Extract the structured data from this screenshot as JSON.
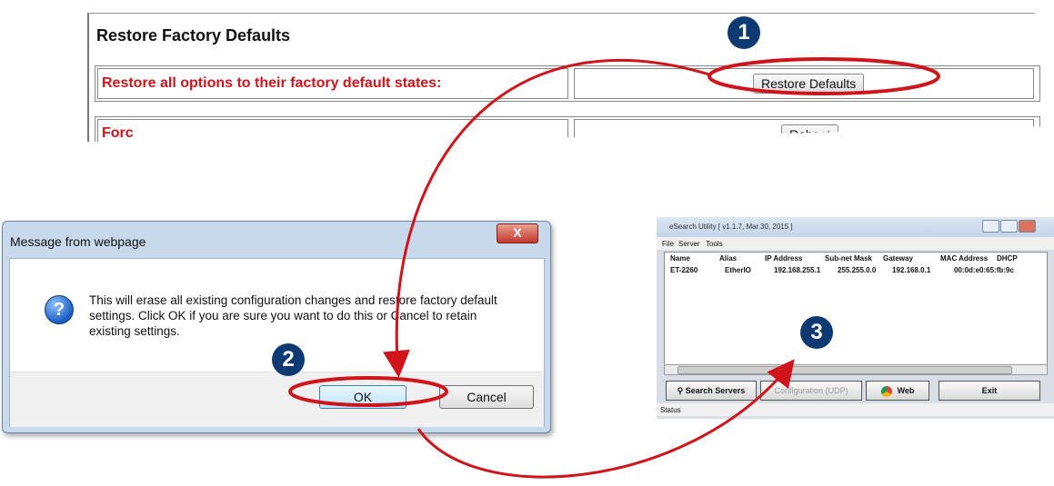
{
  "web": {
    "title": "Restore Factory Defaults",
    "row1_label": "Restore all options to their factory default states:",
    "row1_button": "Restore Defaults",
    "row2_button": "Reboot"
  },
  "dialog": {
    "title": "Message from webpage",
    "close": "X",
    "icon": "question-icon",
    "message": "This will erase all existing configuration changes and restore factory default settings. Click OK if you are sure you want to do this or Cancel to retain existing settings.",
    "ok": "OK",
    "cancel": "Cancel"
  },
  "esearch": {
    "title": "eSearch Utility [ v1.1.7, Mar.30, 2015 ]",
    "menu": [
      "File",
      "Server",
      "Tools"
    ],
    "columns": [
      "Name",
      "Alias",
      "IP Address",
      "Sub-net Mask",
      "Gateway",
      "MAC Address",
      "DHCP"
    ],
    "row": [
      "ET-2260",
      "EtherIO",
      "192.168.255.1",
      "255.255.0.0",
      "192.168.0.1",
      "00:0d:e0:65:fb:9c"
    ],
    "buttons": {
      "search": "Search Servers",
      "config": "Configuration (UDP)",
      "web": "Web",
      "exit": "Exit"
    },
    "status": "Status"
  },
  "steps": [
    "1",
    "2",
    "3"
  ],
  "colors": {
    "highlight": "#d0141c",
    "badge": "#0d3a73",
    "label_red": "#d0141c"
  }
}
